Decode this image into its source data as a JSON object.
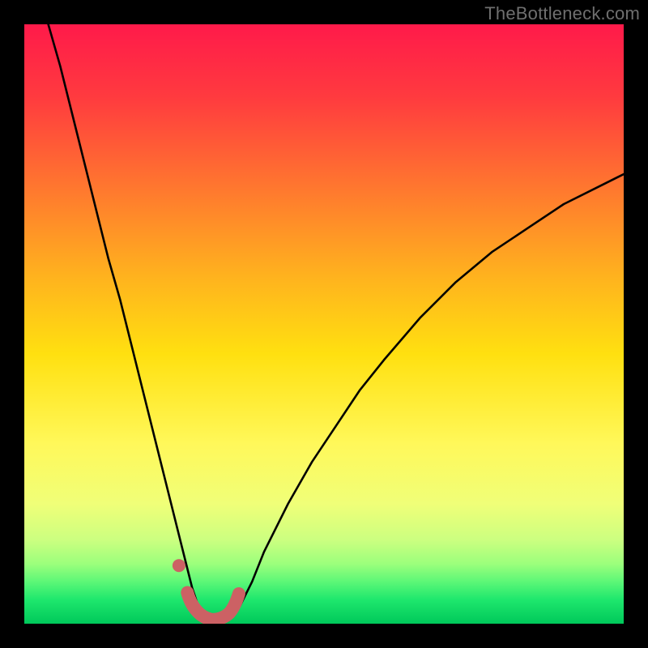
{
  "watermark": "TheBottleneck.com",
  "chart_data": {
    "type": "line",
    "title": "",
    "xlabel": "",
    "ylabel": "",
    "xlim": [
      0,
      100
    ],
    "ylim": [
      0,
      100
    ],
    "grid": false,
    "series": [
      {
        "name": "bottleneck-curve",
        "x": [
          4,
          6,
          8,
          10,
          12,
          14,
          16,
          18,
          20,
          22,
          24,
          25,
          26,
          27,
          28,
          29,
          30,
          31,
          32,
          33,
          34,
          36,
          38,
          40,
          44,
          48,
          52,
          56,
          60,
          66,
          72,
          78,
          84,
          90,
          96,
          100
        ],
        "y": [
          100,
          93,
          85,
          77,
          69,
          61,
          54,
          46,
          38,
          30,
          22,
          18,
          14,
          10,
          6,
          3,
          1,
          0,
          0,
          0,
          1,
          3,
          7,
          12,
          20,
          27,
          33,
          39,
          44,
          51,
          57,
          62,
          66,
          70,
          73,
          75
        ]
      }
    ],
    "markers": [
      {
        "name": "marker-dot",
        "x": 25.8,
        "y": 9.7
      },
      {
        "name": "marker-path-start",
        "x": 27.2,
        "y": 5.2
      },
      {
        "name": "marker-path-end",
        "x": 35.8,
        "y": 5.0
      }
    ],
    "colors": {
      "gradient_stops": [
        {
          "offset": 0,
          "color": "#ff1a4a"
        },
        {
          "offset": 50,
          "color": "#ffd400"
        },
        {
          "offset": 78,
          "color": "#f7ff6a"
        },
        {
          "offset": 87,
          "color": "#d8ff80"
        },
        {
          "offset": 92,
          "color": "#8cff7a"
        },
        {
          "offset": 96,
          "color": "#00e86b"
        },
        {
          "offset": 100,
          "color": "#00c85a"
        }
      ],
      "curve": "#000000",
      "marker": "#cc6164"
    }
  }
}
